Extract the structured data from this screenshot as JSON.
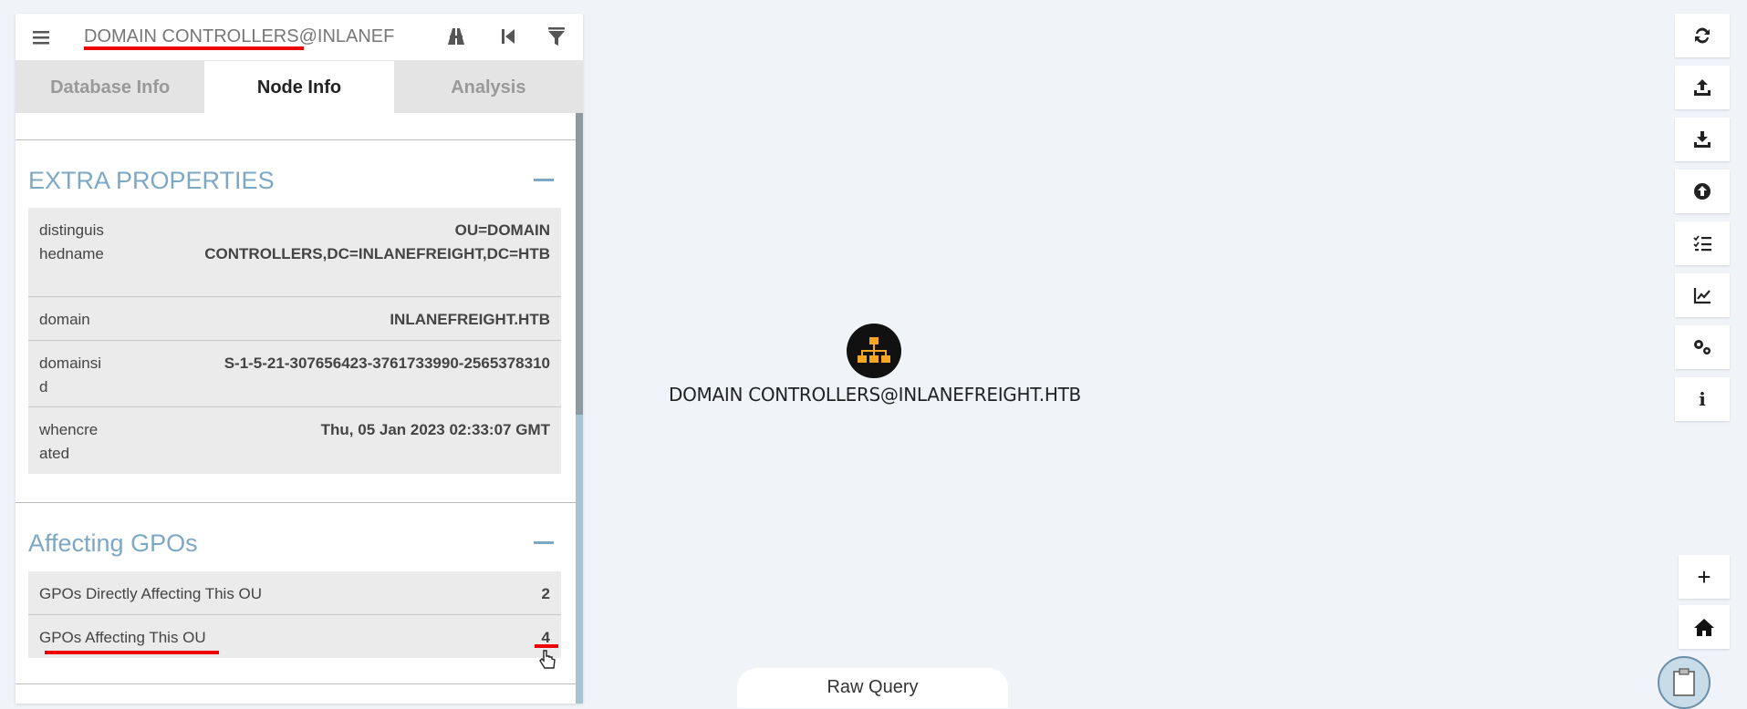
{
  "search": {
    "value": "DOMAIN CONTROLLERS@INLANEFREIGHT.HTB",
    "display": "DOMAIN CONTROLLERS@INLANEF"
  },
  "tabs": [
    {
      "label": "Database Info"
    },
    {
      "label": "Node Info"
    },
    {
      "label": "Analysis"
    }
  ],
  "active_tab": "Node Info",
  "extra_properties": {
    "title": "EXTRA PROPERTIES",
    "rows": [
      {
        "key": "distinguishedname",
        "value": "OU=DOMAIN CONTROLLERS,DC=INLANEFREIGHT,DC=HTB"
      },
      {
        "key": "domain",
        "value": "INLANEFREIGHT.HTB"
      },
      {
        "key": "domainsid",
        "value": "S-1-5-21-307656423-3761733990-2565378310"
      },
      {
        "key": "whencreated",
        "value": "Thu, 05 Jan 2023 02:33:07 GMT"
      }
    ]
  },
  "affecting_gpos": {
    "title": "Affecting GPOs",
    "rows": [
      {
        "key": "GPOs Directly Affecting This OU",
        "value": "2"
      },
      {
        "key": "GPOs Affecting This OU",
        "value": "4"
      }
    ]
  },
  "graph": {
    "node_label": "DOMAIN CONTROLLERS@INLANEFREIGHT.HTB",
    "node_icon": "sitemap-icon",
    "node_color": "#111111",
    "node_icon_color": "#f5a623"
  },
  "raw_query": {
    "label": "Raw Query"
  },
  "toolbar": {
    "icons": [
      "refresh-icon",
      "upload-icon",
      "download-icon",
      "upload-circle-icon",
      "list-check-icon",
      "chart-line-icon",
      "settings-icon",
      "info-icon"
    ],
    "info_glyph": "i",
    "zoom_in": "+",
    "home_icon": "home-icon"
  },
  "colors": {
    "accent": "#7ca8c4",
    "annotation": "#ee0000"
  }
}
